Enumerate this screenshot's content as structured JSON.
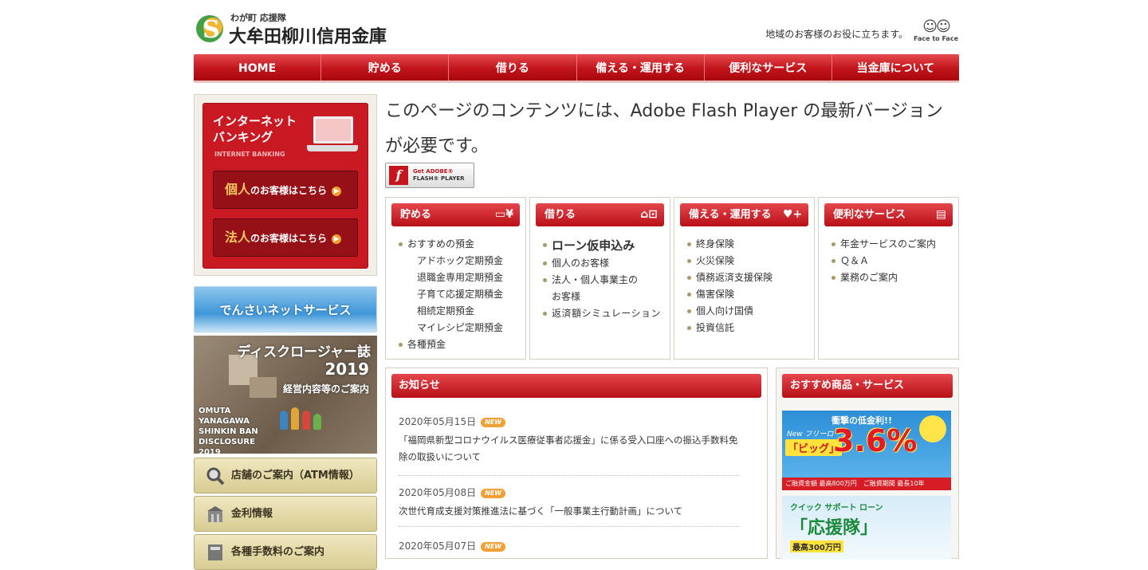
{
  "header": {
    "logo_sub": "わが町 応援隊",
    "logo_main": "大牟田柳川信用金庫",
    "tagline": "地域のお客様のお役に立ちます。",
    "face_to_face": "Face to Face"
  },
  "nav": [
    "HOME",
    "貯める",
    "借りる",
    "備える・運用する",
    "便利なサービス",
    "当金庫について"
  ],
  "internet_banking": {
    "title_line1": "インターネット",
    "title_line2": "バンキング",
    "title_en": "INTERNET BANKING",
    "personal_big": "個人",
    "personal_rest": "のお客様はこちら",
    "corporate_big": "法人",
    "corporate_rest": "のお客様はこちら"
  },
  "densai": "でんさいネットサービス",
  "disclosure": {
    "title": "ディスクロージャー誌",
    "year": "2019",
    "subtitle": "経営内容等のご案内",
    "en_line1": "OMUTA",
    "en_line2": "YANAGAWA",
    "en_line3": "SHINKIN BAN",
    "en_line4": "DISCLOSURE",
    "en_line5": "2019"
  },
  "side_buttons": [
    "店舗のご案内（ATM情報）",
    "金利情報",
    "各種手数料のご案内"
  ],
  "flash": {
    "message": "このページのコンテンツには、Adobe Flash Player の最新バージョンが必要です。",
    "button_line1": "Get ADOBE®",
    "button_line2": "FLASH® PLAYER"
  },
  "categories": [
    {
      "title": "貯める",
      "icon": "wallet-yen-icon",
      "items": [
        {
          "text": "おすすめの預金",
          "type": "dot"
        },
        {
          "text": "アドホック定期預金",
          "type": "sub"
        },
        {
          "text": "退職金専用定期預金",
          "type": "sub"
        },
        {
          "text": "子育て応援定期積金",
          "type": "sub"
        },
        {
          "text": "相続定期預金",
          "type": "sub"
        },
        {
          "text": "マイレシピ定期預金",
          "type": "sub"
        },
        {
          "text": "各種預金",
          "type": "dot"
        }
      ]
    },
    {
      "title": "借りる",
      "icon": "house-car-icon",
      "items": [
        {
          "text": "ローン仮申込み",
          "type": "big"
        },
        {
          "text": "個人のお客様",
          "type": "dot"
        },
        {
          "text": "法人・個人事業主の",
          "type": "dot"
        },
        {
          "text": "お客様",
          "type": "cont"
        },
        {
          "text": "返済額シミュレーション",
          "type": "dot"
        }
      ]
    },
    {
      "title": "備える・運用する",
      "icon": "heart-plus-icon",
      "items": [
        {
          "text": "終身保険",
          "type": "dot"
        },
        {
          "text": "火災保険",
          "type": "dot"
        },
        {
          "text": "債務返済支援保険",
          "type": "dot"
        },
        {
          "text": "傷害保険",
          "type": "dot"
        },
        {
          "text": "個人向け国債",
          "type": "dot"
        },
        {
          "text": "投資信託",
          "type": "dot"
        }
      ]
    },
    {
      "title": "便利なサービス",
      "icon": "card-icon",
      "items": [
        {
          "text": "年金サービスのご案内",
          "type": "dot"
        },
        {
          "text": "Ｑ＆Ａ",
          "type": "dot"
        },
        {
          "text": "業務のご案内",
          "type": "dot"
        }
      ]
    }
  ],
  "news": {
    "title": "お知らせ",
    "badge": "NEW",
    "items": [
      {
        "date": "2020年05月15日",
        "text": "「福岡県新型コロナウイルス医療従事者応援金」に係る受入口座への振込手数料免除の取扱いについて"
      },
      {
        "date": "2020年05月08日",
        "text": "次世代育成支援対策推進法に基づく「一般事業主行動計画」について"
      },
      {
        "date": "2020年05月07日",
        "text": ""
      }
    ]
  },
  "recommended": {
    "title": "おすすめ商品・サービス",
    "banner1": {
      "catch": "衝撃の低金利!!",
      "new": "New フリーローン",
      "name": "「ビッグ」",
      "rate": "3.6%",
      "bottom": "ご融資金額 最高800万円　ご融資期間 最長10年"
    },
    "banner2": {
      "catch": "クイック サポート ローン",
      "name": "「応援隊」",
      "amount": "最高300万円"
    }
  }
}
